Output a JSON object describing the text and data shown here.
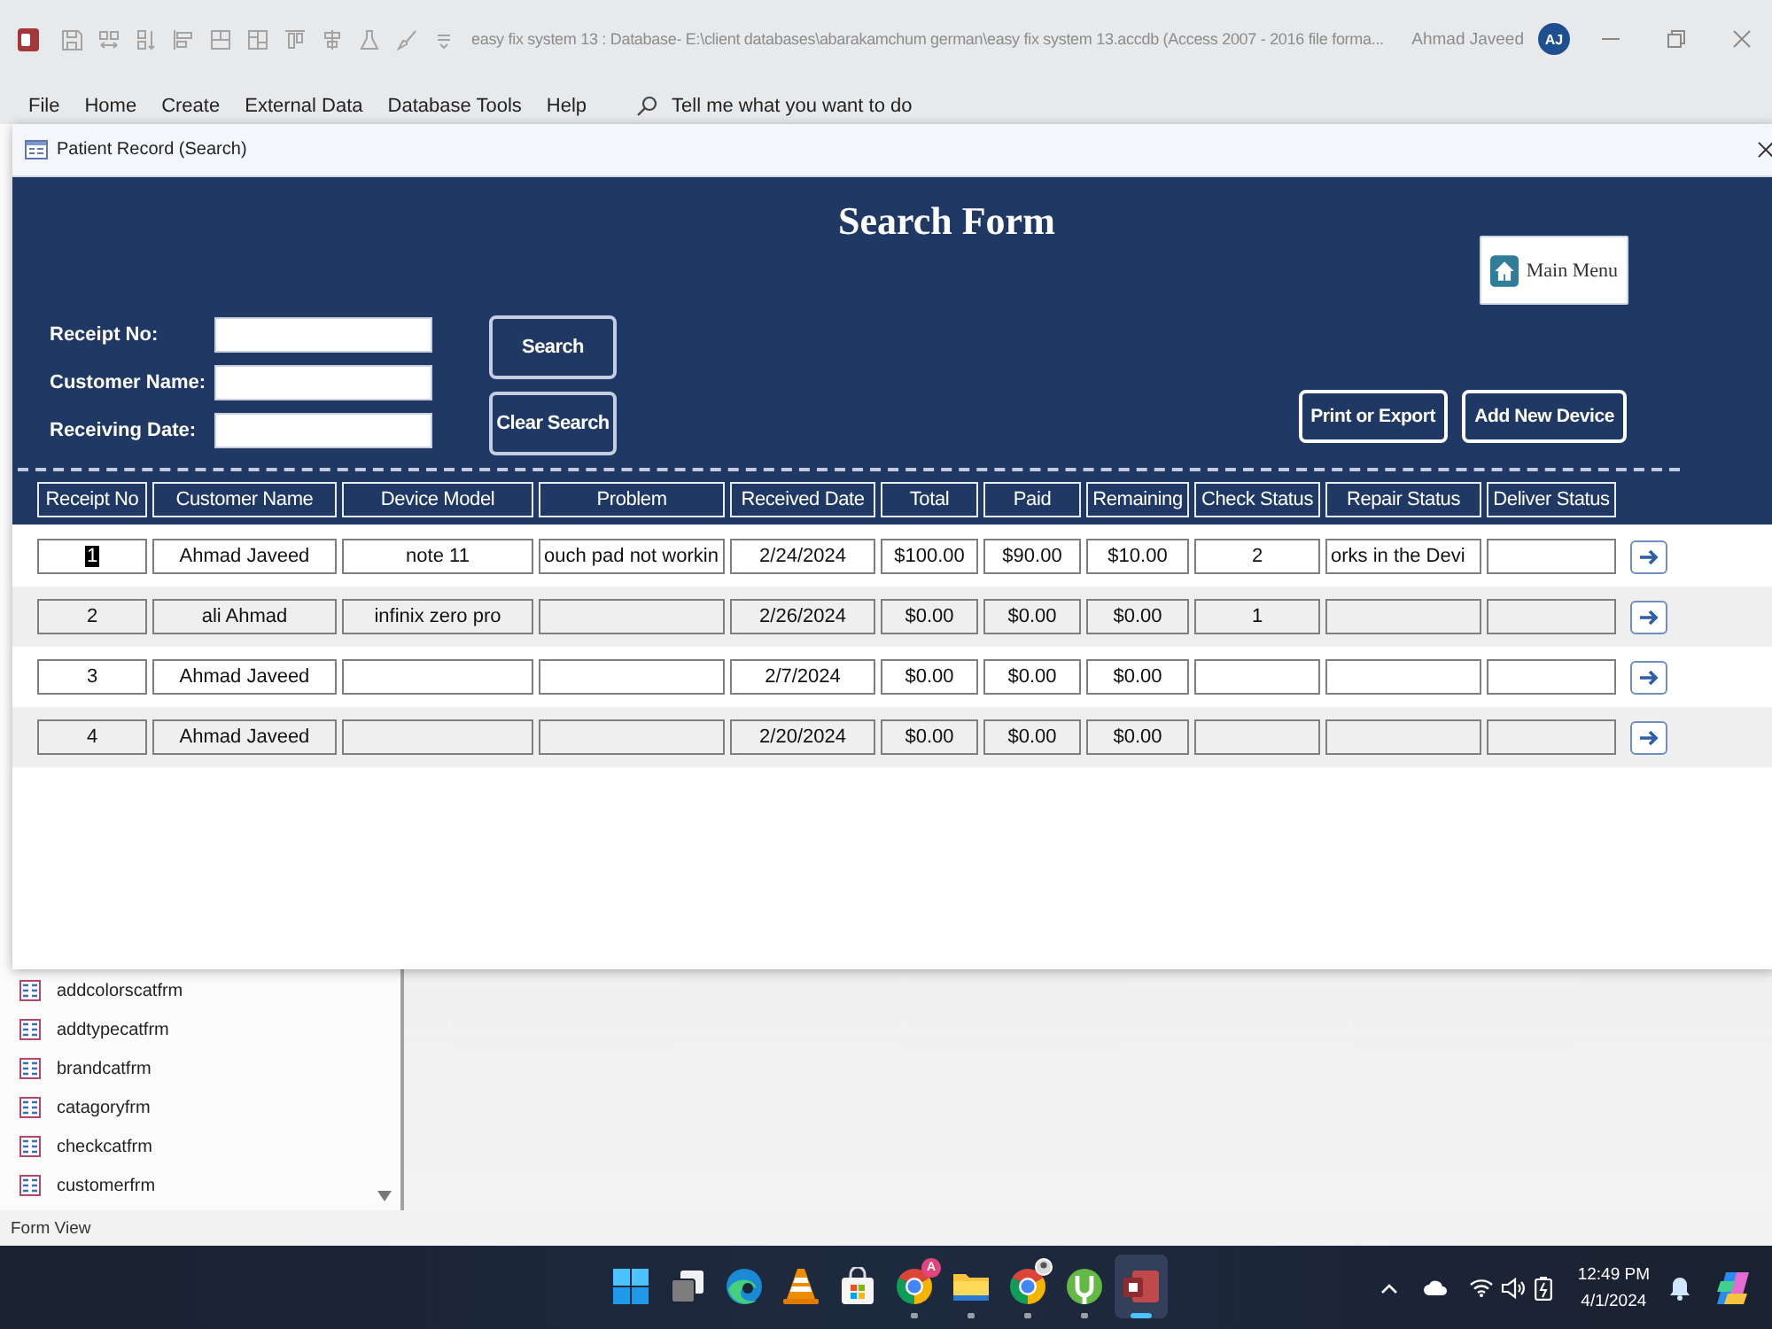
{
  "app_window": {
    "title": "easy fix system 13 : Database- E:\\client databases\\abarakamchum german\\easy fix system 13.accdb (Access 2007 - 2016 file forma...",
    "user_name": "Ahmad Javeed",
    "user_initials": "AJ"
  },
  "ribbon_tabs": [
    "File",
    "Home",
    "Create",
    "External Data",
    "Database Tools",
    "Help"
  ],
  "tell_me": {
    "placeholder": "Tell me what you want to do"
  },
  "form_window": {
    "title": "Patient Record (Search)"
  },
  "search_form": {
    "title": "Search Form",
    "main_menu_button": "Main Menu",
    "fields": [
      {
        "label": "Receipt No:"
      },
      {
        "label": "Customer Name:"
      },
      {
        "label": "Receiving Date:"
      }
    ],
    "search_buttons": [
      "Search",
      "Clear Search"
    ],
    "action_buttons": [
      "Print or Export",
      "Add New Device"
    ]
  },
  "table": {
    "columns": [
      "Receipt No",
      "Customer Name",
      "Device Model",
      "Problem",
      "Received Date",
      "Total",
      "Paid",
      "Remaining",
      "Check Status",
      "Repair Status",
      "Deliver Status"
    ],
    "rows": [
      {
        "selected": true,
        "cells": [
          "1",
          "Ahmad Javeed",
          "note 11",
          "ouch pad not workin",
          "2/24/2024",
          "$100.00",
          "$90.00",
          "$10.00",
          "2",
          "orks in the Devi",
          null
        ]
      },
      {
        "selected": false,
        "cells": [
          "2",
          "ali Ahmad",
          "infinix zero pro",
          null,
          "2/26/2024",
          "$0.00",
          "$0.00",
          "$0.00",
          "1",
          null,
          null
        ]
      },
      {
        "selected": false,
        "cells": [
          "3",
          "Ahmad Javeed",
          null,
          null,
          "2/7/2024",
          "$0.00",
          "$0.00",
          "$0.00",
          null,
          null,
          null
        ]
      },
      {
        "selected": false,
        "cells": [
          "4",
          "Ahmad Javeed",
          null,
          null,
          "2/20/2024",
          "$0.00",
          "$0.00",
          "$0.00",
          null,
          null,
          null
        ]
      }
    ]
  },
  "nav_pane": {
    "items": [
      "addcolorscatfrm",
      "addtypecatfrm",
      "brandcatfrm",
      "catagoryfrm",
      "checkcatfrm",
      "customerfrm"
    ]
  },
  "status_bar": {
    "text": "Form View"
  },
  "taskbar": {
    "apps": [
      {
        "kind": "start",
        "running": false,
        "selected": false
      },
      {
        "kind": "task-view",
        "running": false,
        "selected": false
      },
      {
        "kind": "browser-swirl",
        "running": false,
        "selected": false
      },
      {
        "kind": "cone",
        "running": false,
        "selected": false
      },
      {
        "kind": "bag",
        "running": false,
        "selected": false
      },
      {
        "kind": "browser-round",
        "badge": "A",
        "running": true,
        "selected": false
      },
      {
        "kind": "folder",
        "running": true,
        "selected": false
      },
      {
        "kind": "browser-profile",
        "running": true,
        "selected": false
      },
      {
        "kind": "torrent",
        "running": true,
        "selected": false
      },
      {
        "kind": "database",
        "running": true,
        "selected": true
      }
    ],
    "clock": {
      "time": "12:49 PM",
      "date": "4/1/2024"
    }
  }
}
